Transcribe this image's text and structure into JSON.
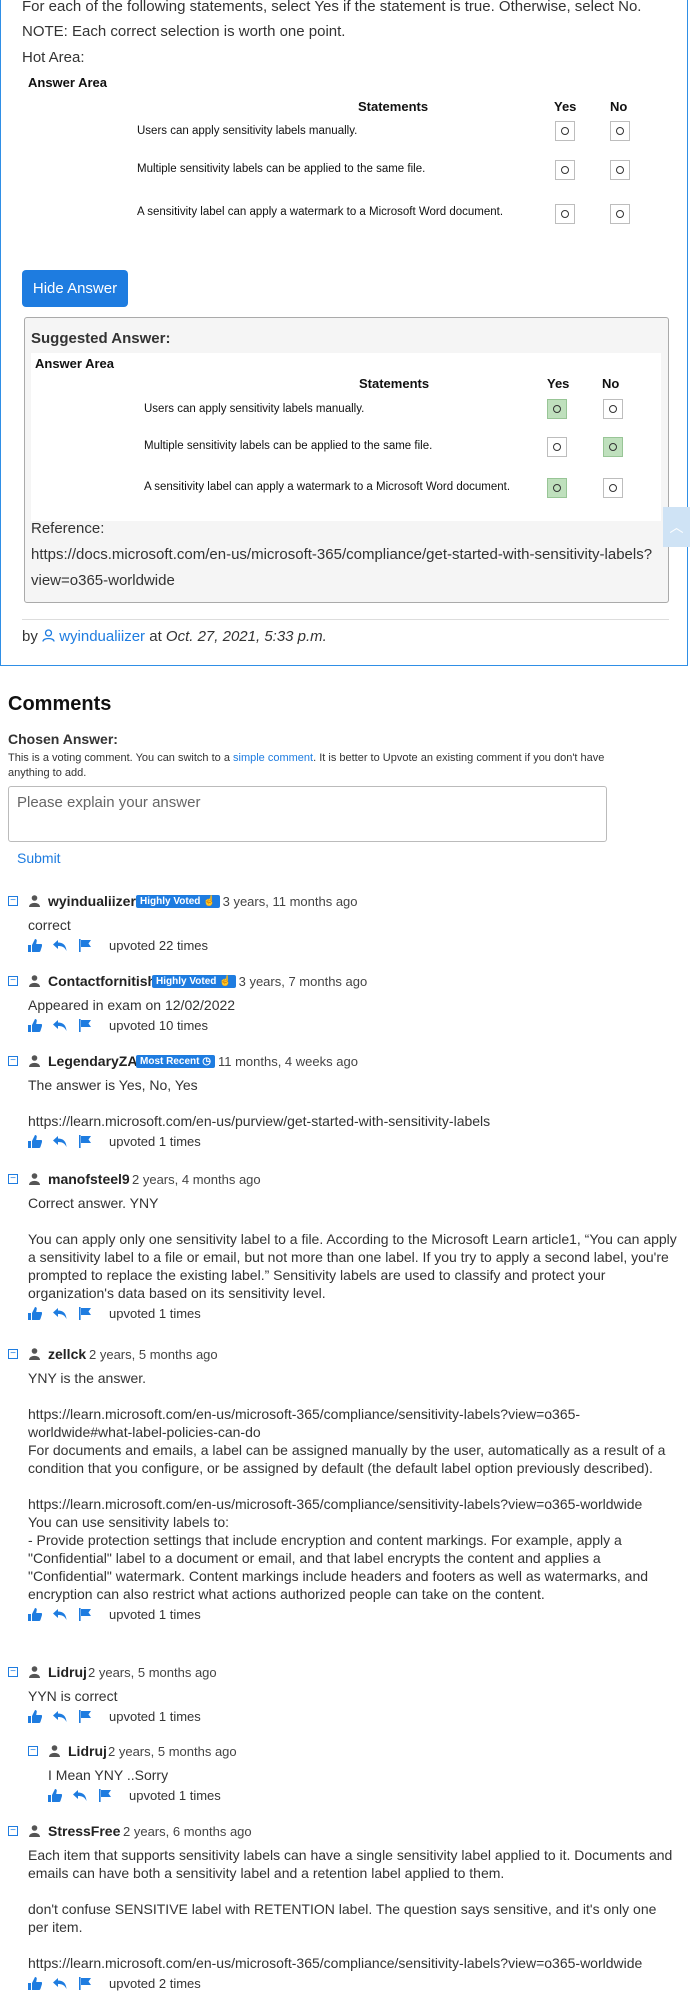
{
  "question": {
    "lines": [
      "For each of the following statements, select Yes if the statement is true. Otherwise, select No.",
      "NOTE: Each correct selection is worth one point.",
      "Hot Area:"
    ],
    "answer_area_title": "Answer Area",
    "col_statements": "Statements",
    "col_yes": "Yes",
    "col_no": "No",
    "statements": [
      "Users can apply sensitivity labels manually.",
      "Multiple sensitivity labels can be applied to the same file.",
      "A sensitivity label can apply a watermark to a Microsoft Word document."
    ]
  },
  "hide_answer_label": "Hide Answer",
  "suggested": {
    "title": "Suggested Answer:",
    "answer_area_title": "Answer Area",
    "col_statements": "Statements",
    "col_yes": "Yes",
    "col_no": "No",
    "statements": [
      "Users can apply sensitivity labels manually.",
      "Multiple sensitivity labels can be applied to the same file.",
      "A sensitivity label can apply a watermark to a Microsoft Word document."
    ],
    "selected": [
      "yes",
      "no",
      "yes"
    ],
    "reference_label": "Reference:",
    "reference_url_1": "https://docs.microsoft.com/en-us/microsoft-365/compliance/get-started-with-sensitivity-labels?",
    "reference_url_2": "view=o365-worldwide",
    "selected_color": "#bfe0bd"
  },
  "byline": {
    "by": "by",
    "user": "wyindualiizer",
    "at": "at",
    "date": "Oct. 27, 2021, 5:33 p.m."
  },
  "comments_section": {
    "title": "Comments",
    "chosen_answer": "Chosen Answer:",
    "note_1": "This is a voting comment. You can switch to a ",
    "note_link": "simple comment",
    "note_2": ". It is better to Upvote an existing comment if you don't have anything to add.",
    "placeholder": "Please explain your answer",
    "submit": "Submit"
  },
  "comments": [
    {
      "user": "wyindualiizer",
      "badge": "Highly Voted",
      "time": "3 years, 11 months ago",
      "body": "correct",
      "upvotes": "upvoted 22 times"
    },
    {
      "user": "Contactfornitish",
      "badge": "Highly Voted",
      "time": "3 years, 7 months ago",
      "body": "Appeared in exam on 12/02/2022",
      "upvotes": "upvoted 10 times"
    },
    {
      "user": "LegendaryZA",
      "badge": "Most Recent",
      "time": "11 months, 4 weeks ago",
      "body": "The answer is Yes, No, Yes\n\nhttps://learn.microsoft.com/en-us/purview/get-started-with-sensitivity-labels",
      "upvotes": "upvoted 1 times"
    },
    {
      "user": "manofsteel9",
      "badge": "",
      "time": "2 years, 4 months ago",
      "body": "Correct answer. YNY\n\nYou can apply only one sensitivity label to a file. According to the Microsoft Learn article1, “You can apply a sensitivity label to a file or email, but not more than one label. If you try to apply a second label, you're prompted to replace the existing label.” Sensitivity labels are used to classify and protect your organization's data based on its sensitivity level.",
      "upvotes": "upvoted 1 times"
    },
    {
      "user": "zellck",
      "badge": "",
      "time": "2 years, 5 months ago",
      "body": "YNY is the answer.\n\nhttps://learn.microsoft.com/en-us/microsoft-365/compliance/sensitivity-labels?view=o365-worldwide#what-label-policies-can-do\nFor documents and emails, a label can be assigned manually by the user, automatically as a result of a condition that you configure, or be assigned by default (the default label option previously described).\n\nhttps://learn.microsoft.com/en-us/microsoft-365/compliance/sensitivity-labels?view=o365-worldwide\nYou can use sensitivity labels to:\n- Provide protection settings that include encryption and content markings. For example, apply a \"Confidential\" label to a document or email, and that label encrypts the content and applies a \"Confidential\" watermark. Content markings include headers and footers as well as watermarks, and encryption can also restrict what actions authorized people can take on the content.",
      "upvotes": "upvoted 1 times"
    },
    {
      "user": "Lidruj",
      "badge": "",
      "time": "2 years, 5 months ago",
      "body": "YYN is correct",
      "upvotes": "upvoted 1 times"
    },
    {
      "user": "Lidruj",
      "badge": "",
      "time": "2 years, 5 months ago",
      "body": "I Mean YNY ..Sorry",
      "upvotes": "upvoted 1 times"
    },
    {
      "user": "StressFree",
      "badge": "",
      "time": "2 years, 6 months ago",
      "body": "Each item that supports sensitivity labels can have a single sensitivity label applied to it. Documents and emails can have both a sensitivity label and a retention label applied to them.\n\ndon't confuse SENSITIVE label with RETENTION label. The question says sensitive, and it's only one per item.\n\nhttps://learn.microsoft.com/en-us/microsoft-365/compliance/sensitivity-labels?view=o365-worldwide",
      "upvotes": "upvoted 2 times"
    }
  ],
  "colors": {
    "accent": "#1e7ce0",
    "border": "#2f8fe6"
  }
}
